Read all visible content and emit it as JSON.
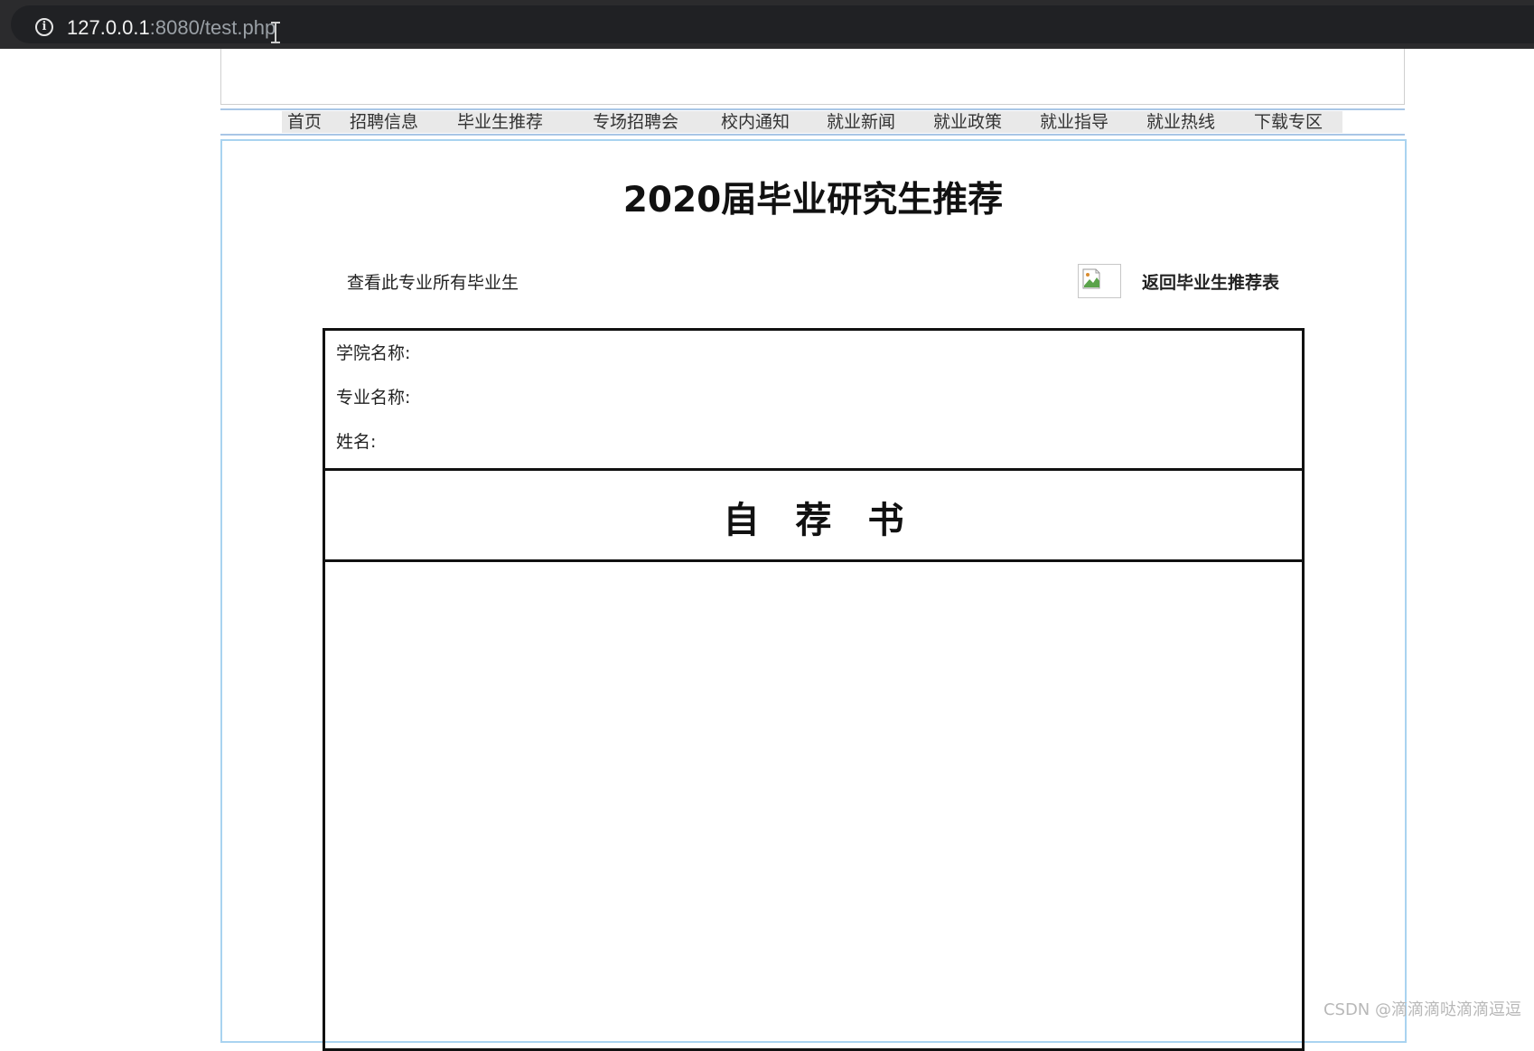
{
  "browser": {
    "url_host": "127.0.0.1",
    "url_path": ":8080/test.php",
    "info_icon": "i"
  },
  "nav": {
    "items": [
      {
        "label": "首页"
      },
      {
        "label": "招聘信息"
      },
      {
        "label": "毕业生推荐"
      },
      {
        "label": "专场招聘会"
      },
      {
        "label": "校内通知"
      },
      {
        "label": "就业新闻"
      },
      {
        "label": "就业政策"
      },
      {
        "label": "就业指导"
      },
      {
        "label": "就业热线"
      },
      {
        "label": "下载专区"
      }
    ]
  },
  "main": {
    "title": "2020届毕业研究生推荐",
    "view_all_link": "查看此专业所有毕业生",
    "back_link": "返回毕业生推荐表"
  },
  "form": {
    "college_label": "学院名称:",
    "major_label": "专业名称:",
    "name_label": "姓名:",
    "section_heading": "自荐书"
  },
  "watermark": "CSDN @滴滴滴哒滴滴逗逗",
  "colors": {
    "browser_bar": "#2b2b2d",
    "nav_line": "#a9c6e6",
    "frame_border": "#a9d3f0",
    "nav_background": "#e9e9e9"
  }
}
